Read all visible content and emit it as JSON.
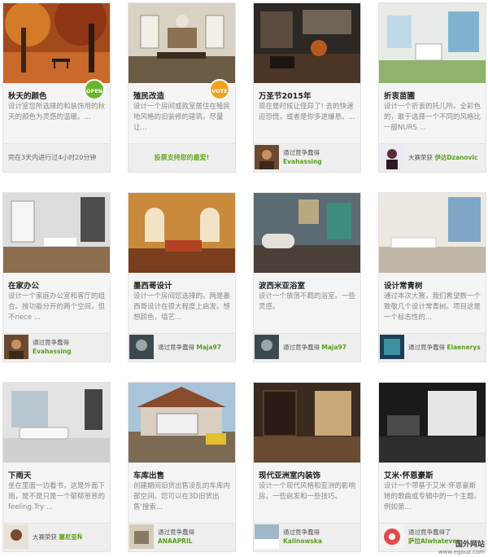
{
  "cards": [
    {
      "title": "秋天的颜色",
      "desc": "设计室您所选择的和装饰用的秋天的颜色为灵感的温暖。...",
      "badge": "OPEN",
      "badge_color": "#6bb52b",
      "footer_type": "status",
      "footer_text": "完在3天内进行过4小时20分钟"
    },
    {
      "title": "殖民改造",
      "desc": "设计一个房间或款室居住在殖民地风格的旧装修的建筑。尽量让...",
      "badge": "VOTE",
      "badge_color": "#f0a21f",
      "footer_type": "vote",
      "footer_text": "投票支持您的最爱!"
    },
    {
      "title": "万圣节2015年",
      "desc": "现在是时候让怪异了! 去的快速迎恐慌，或者是你多进爆恳。...",
      "footer_type": "winner",
      "winner_prefix": "通过竟争蠢得",
      "winner_name": "Evahassing"
    },
    {
      "title": "折衷苗圃",
      "desc": "设计一个折衷的托儿所。全彩色的，敢于选择一个不同的风格比一般NURS ...",
      "footer_type": "winner",
      "winner_prefix": "大赛荣获",
      "winner_name": "伊达Dzanovic"
    },
    {
      "title": "在家办公",
      "desc": "设计一个家庭办公室和客厅的组合。按功能分开的两个空间，但不nece ...",
      "footer_type": "winner",
      "winner_prefix": "通过竟争蠢得",
      "winner_name": "Evahassing"
    },
    {
      "title": "墨西哥设计",
      "desc": "设计一个房间您选择的。两是墨西哥设计在很大程度上启发。想想颜色，墙艺...",
      "footer_type": "winner",
      "winner_prefix": "通过竟争蠢得",
      "winner_name": "Maja97"
    },
    {
      "title": "波西米亚浴室",
      "desc": "设计一个放荡不羁的浴室。一些灵感。",
      "footer_type": "winner",
      "winner_prefix": "通过竟争蠢得",
      "winner_name": "Maja97"
    },
    {
      "title": "设计常青树",
      "desc": "通过本次大赛，我们希望数一个致敬几个设计常青树。项目这是一个标志性的...",
      "footer_type": "winner",
      "winner_prefix": "通过竟争蠢得",
      "winner_name": "Elaenerys"
    },
    {
      "title": "下雨天",
      "desc": "坐在里面一边看书，这是外面下雨，是不是只是一个郁郁葱葱的feeling.Try ...",
      "footer_type": "winner",
      "winner_prefix": "大赛荣获",
      "winner_name": "塞尼亚Ñ"
    },
    {
      "title": "车库出售",
      "desc": "创建期间旧货出售凌乱的车库内部空间。您可以在3D旧货出售'搜索...",
      "footer_type": "winner",
      "winner_prefix": "通过竟争蠢得",
      "winner_name": "ANAAPRIL"
    },
    {
      "title": "现代亚洲室内装饰",
      "desc": "设计一个现代风格和亚洲的影响房。一些启发和一些技巧。",
      "footer_type": "winner",
      "winner_prefix": "通过竟争蠢得",
      "winner_name": "Kalinowska"
    },
    {
      "title": "艾米·怀恩豪斯",
      "desc": "设计一个带基于艾米·怀恩豪斯她的歌曲或专辑中的一个主题。例如第...",
      "footer_type": "winner",
      "winner_prefix": "通过竟争蠢得了",
      "winner_name": "萨拉Alwhatever"
    }
  ],
  "watermark": {
    "line1": "国外网站",
    "line2": "www.egouz.com"
  }
}
